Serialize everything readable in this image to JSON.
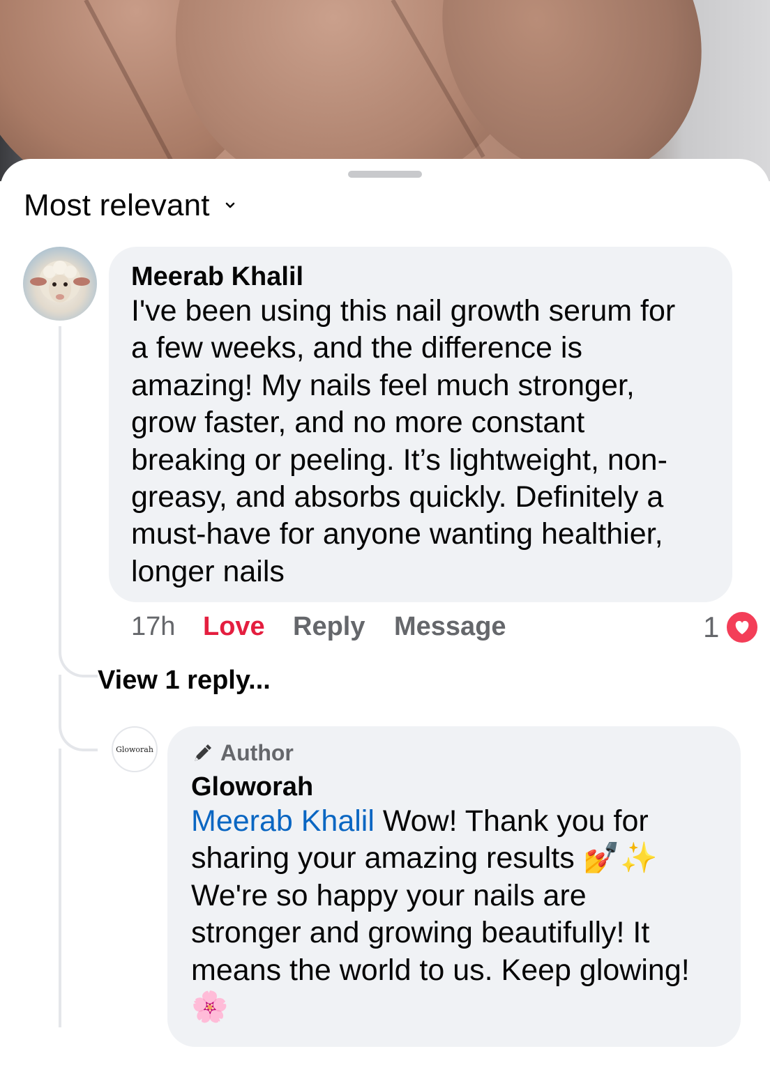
{
  "sort": {
    "label": "Most relevant"
  },
  "comment": {
    "author": "Meerab Khalil",
    "lines": [
      "I've been using this nail growth serum for",
      "a few weeks, and the difference is",
      "amazing! My nails feel much stronger,",
      "grow faster, and no more constant",
      "breaking or peeling. It’s lightweight, non-",
      "greasy, and absorbs quickly. Definitely a",
      "must-have for anyone wanting healthier,",
      "longer nails"
    ],
    "time": "17h",
    "love_label": "Love",
    "reply_label": "Reply",
    "message_label": "Message",
    "reaction_count": "1",
    "reaction_icon": "heart-icon"
  },
  "view_replies": "View 1 reply...",
  "reply": {
    "avatar_text": "Gloworah",
    "badge_label": "Author",
    "badge_icon": "pen-icon",
    "author": "Gloworah",
    "mention": "Meerab Khalil",
    "line1_rest": " Wow! Thank you for",
    "line2": "sharing your amazing results 💅✨",
    "line3": "We're so happy your nails are",
    "line4": "stronger and growing beautifully! It",
    "line5": "means the world to us. Keep glowing!",
    "line6": "🌸"
  },
  "colors": {
    "love": "#e41e3f",
    "mention": "#0a66c2",
    "bubble": "#f0f2f5",
    "muted": "#65676b"
  }
}
